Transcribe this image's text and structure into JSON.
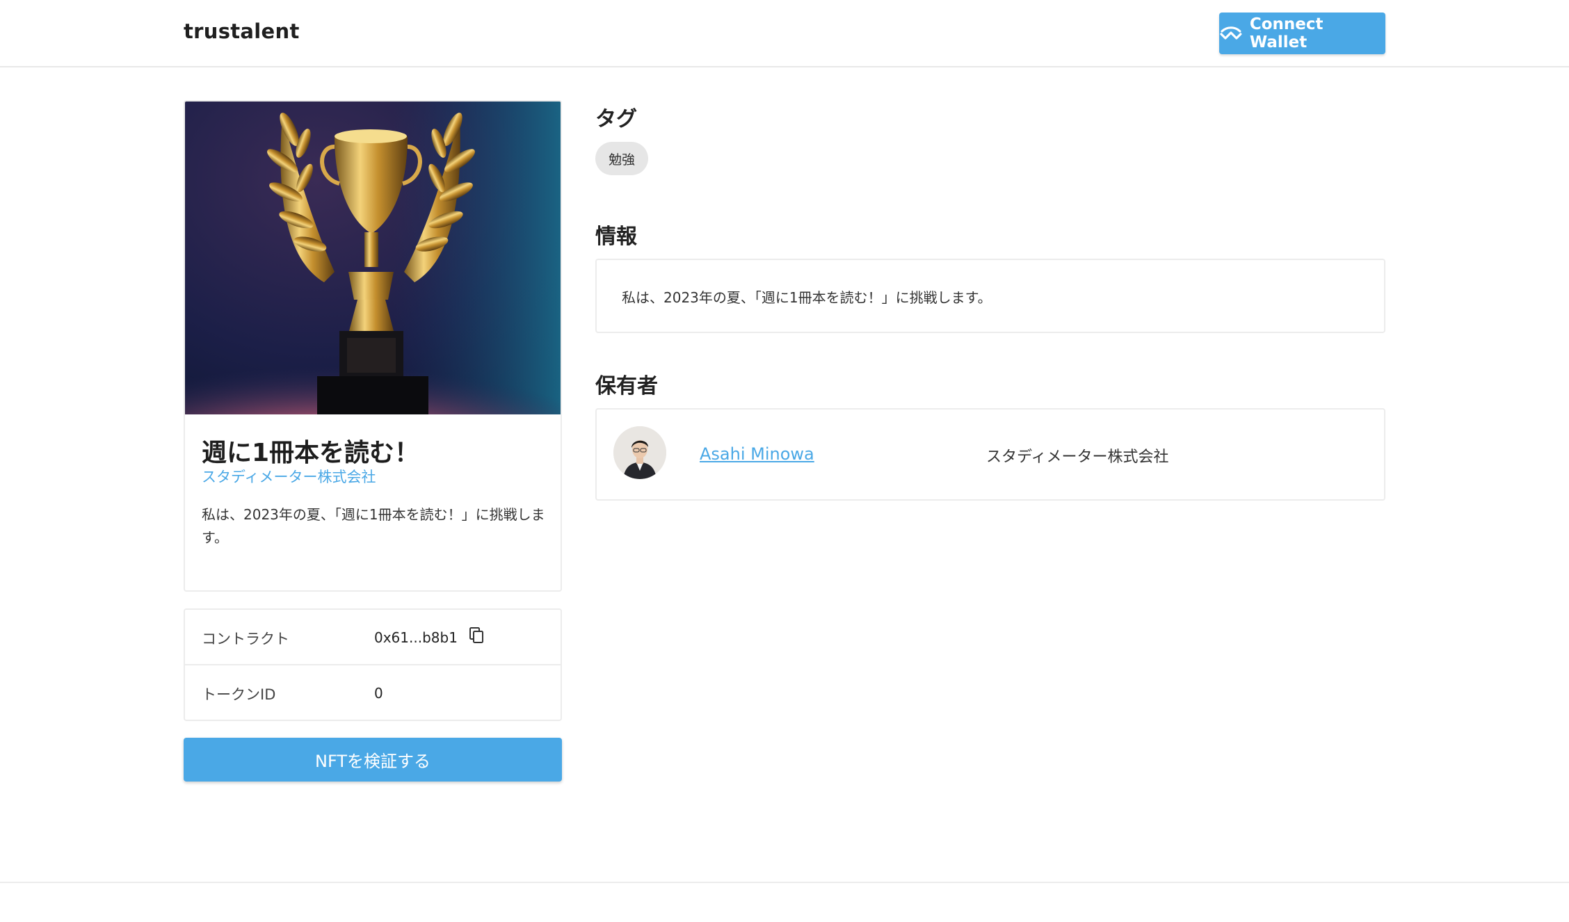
{
  "header": {
    "brand": "trustalent",
    "connect_wallet_label": "Connect Wallet",
    "connect_wallet_icon": "walletconnect-icon"
  },
  "nft": {
    "image_alt_icon": "trophy-image",
    "title": "週に1冊本を読む！",
    "issuer": "スタディメーター株式会社",
    "description": "私は、2023年の夏、「週に1冊本を読む！」に挑戦します。"
  },
  "details": {
    "contract_label": "コントラクト",
    "contract_value": "0x61...b8b1",
    "token_label": "トークンID",
    "token_value": "0"
  },
  "verify_button_label": "NFTを検証する",
  "tags_section": {
    "heading": "タグ",
    "tags": [
      "勉強"
    ]
  },
  "info_section": {
    "heading": "情報",
    "text": "私は、2023年の夏、「週に1冊本を読む！」に挑戦します。"
  },
  "holders_section": {
    "heading": "保有者",
    "holder_name": "Asahi Minowa",
    "holder_company": "スタディメーター株式会社"
  },
  "colors": {
    "accent": "#4aa8e6",
    "border": "#ececec",
    "chip": "#e6e6e6"
  }
}
